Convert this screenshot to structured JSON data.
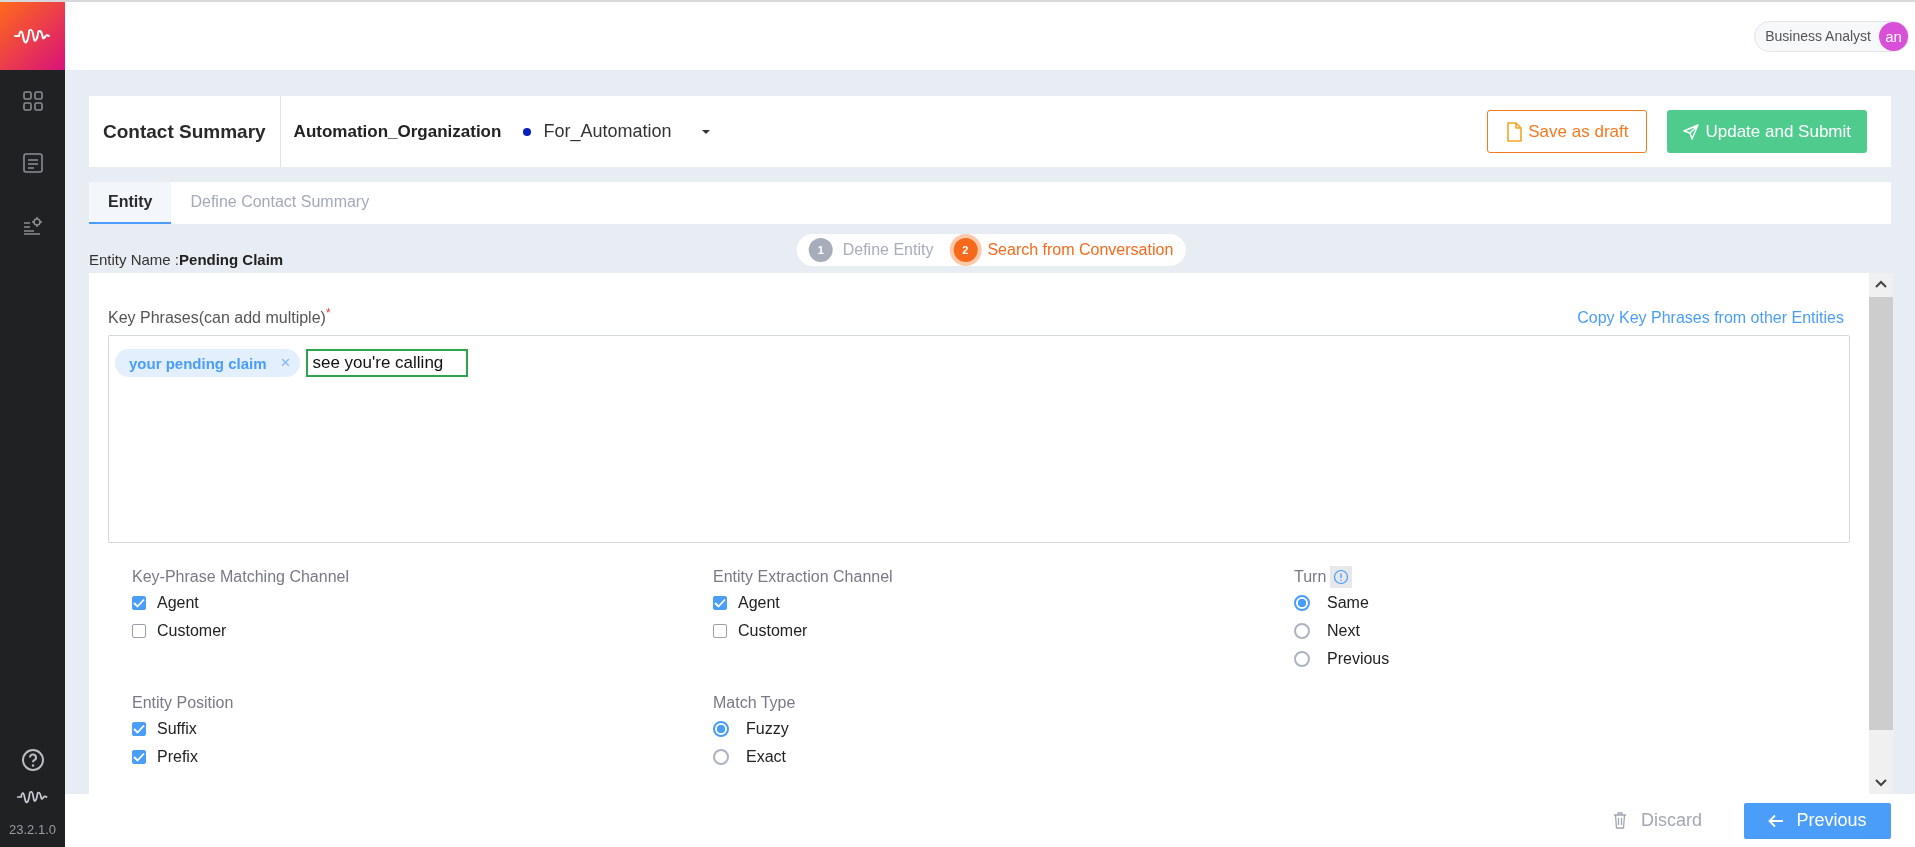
{
  "topbar": {
    "role": "Business Analyst",
    "avatar": "an"
  },
  "header": {
    "title": "Contact Summary",
    "organization": "Automation_Organization",
    "workspace": "For_Automation",
    "buttons": [
      {
        "kind": "draft",
        "label": "Save as draft"
      },
      {
        "kind": "submit",
        "label": "Update and Submit"
      }
    ]
  },
  "tabs": [
    {
      "label": "Entity",
      "selected": true
    },
    {
      "label": "Define Contact Summary",
      "selected": false
    }
  ],
  "entity_name": {
    "label": "Entity Name :",
    "value": "Pending Claim"
  },
  "stepper": [
    {
      "number": "1",
      "label": "Define Entity",
      "selected": false
    },
    {
      "number": "2",
      "label": "Search from Conversation",
      "selected": true
    }
  ],
  "key_phrases": {
    "label": "Key Phrases(can add multiple)",
    "required_mark": "*",
    "copy_link": "Copy Key Phrases from other Entities",
    "chips": [
      {
        "label": "your pending claim",
        "remove": "×"
      }
    ],
    "input_value": "see you're calling"
  },
  "sections": [
    {
      "label": "Key-Phrase Matching Channel",
      "kind": "checkbox",
      "options": [
        {
          "label": "Agent",
          "checked": true
        },
        {
          "label": "Customer",
          "checked": false
        }
      ]
    },
    {
      "label": "Entity Extraction Channel",
      "kind": "checkbox",
      "options": [
        {
          "label": "Agent",
          "checked": true
        },
        {
          "label": "Customer",
          "checked": false
        }
      ]
    },
    {
      "label": "Turn",
      "kind": "radio",
      "info": true,
      "options": [
        {
          "label": "Same",
          "selected": true
        },
        {
          "label": "Next",
          "selected": false
        },
        {
          "label": "Previous",
          "selected": false
        }
      ]
    },
    {
      "label": "Entity Position",
      "kind": "checkbox",
      "options": [
        {
          "label": "Suffix",
          "checked": true
        },
        {
          "label": "Prefix",
          "checked": true
        }
      ]
    },
    {
      "label": "Match Type",
      "kind": "radio",
      "options": [
        {
          "label": "Fuzzy",
          "selected": true
        },
        {
          "label": "Exact",
          "selected": false
        }
      ]
    }
  ],
  "footer": {
    "buttons": [
      {
        "kind": "discard",
        "label": "Discard"
      },
      {
        "kind": "previous",
        "label": "Previous"
      }
    ]
  },
  "version": "23.2.1.0"
}
